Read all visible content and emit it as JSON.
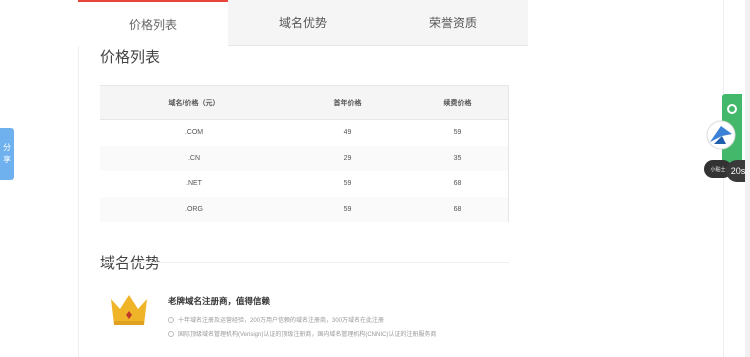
{
  "tabs": [
    {
      "label": "价格列表",
      "active": true
    },
    {
      "label": "域名优势",
      "active": false
    },
    {
      "label": "荣誉资质",
      "active": false
    }
  ],
  "price_section": {
    "title": "价格列表"
  },
  "price_table": {
    "headers": [
      "域名/价格（元）",
      "首年价格",
      "续费价格"
    ],
    "rows": [
      [
        ".COM",
        "49",
        "59"
      ],
      [
        ".CN",
        "29",
        "35"
      ],
      [
        ".NET",
        "59",
        "68"
      ],
      [
        ".ORG",
        "59",
        "68"
      ]
    ]
  },
  "advantage_section": {
    "title": "域名优势",
    "heading": "老牌域名注册商，值得信赖",
    "points": [
      "十年域名注册及运营经验，200万用户信赖的域名注册商，300万域名在此注册",
      "国际顶级域名管理机构(Verisign)认证的顶级注册商，国内域名管理机构(CNNIC)认证的注册服务商"
    ]
  },
  "share": {
    "label_1": "分",
    "label_2": "享"
  },
  "float": {
    "badge": "20s",
    "pill_text": "小贴士"
  },
  "colors": {
    "accent": "#e8463a",
    "green": "#43b86a",
    "share_blue": "#6fb1ef",
    "crown": "#f0b429"
  }
}
